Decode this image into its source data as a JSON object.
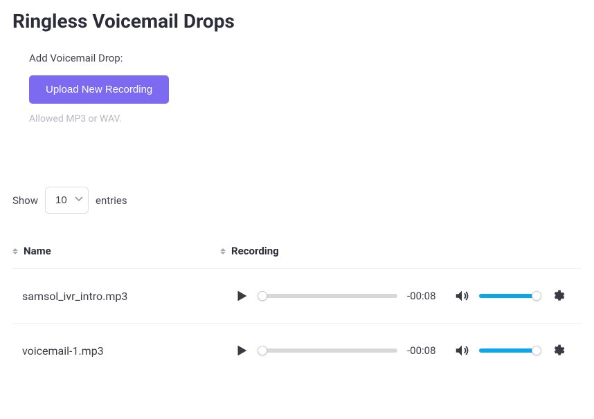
{
  "page": {
    "title": "Ringless Voicemail Drops"
  },
  "upload": {
    "label": "Add Voicemail Drop:",
    "button_label": "Upload New Recording",
    "hint": "Allowed MP3 or WAV."
  },
  "entries": {
    "show_label": "Show",
    "entries_label": "entries",
    "selected": "10"
  },
  "table": {
    "columns": {
      "name": "Name",
      "recording": "Recording"
    },
    "rows": [
      {
        "name": "samsol_ivr_intro.mp3",
        "time": "-00:08"
      },
      {
        "name": "voicemail-1.mp3",
        "time": "-00:08"
      }
    ]
  }
}
